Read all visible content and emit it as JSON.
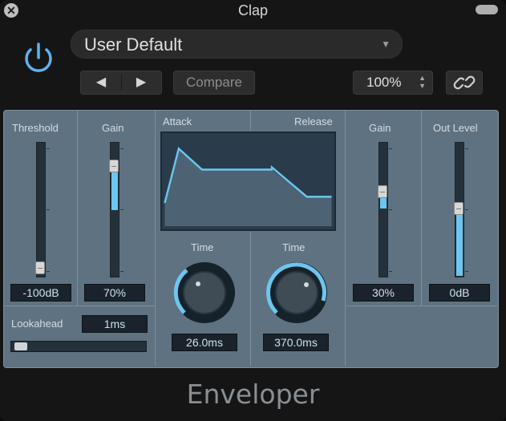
{
  "window": {
    "title": "Clap"
  },
  "header": {
    "preset": "User Default",
    "nav_prev": "◀",
    "nav_next": "▶",
    "compare": "Compare",
    "zoom": "100%"
  },
  "threshold": {
    "label": "Threshold",
    "value": "-100dB",
    "fraction": 0.0
  },
  "gain_left": {
    "label": "Gain",
    "value": "70%",
    "fraction": 0.7
  },
  "lookahead": {
    "label": "Lookahead",
    "value": "1ms"
  },
  "attack": {
    "section_label": "Attack",
    "time_label": "Time",
    "value": "26.0ms"
  },
  "release": {
    "section_label": "Release",
    "time_label": "Time",
    "value": "370.0ms"
  },
  "gain_right": {
    "label": "Gain",
    "value": "30%",
    "fraction": 0.3
  },
  "out_level": {
    "label": "Out Level",
    "value": "0dB"
  },
  "brand": "Enveloper",
  "colors": {
    "accent": "#6cc6ef",
    "panel": "#5f7281",
    "display": "#2a3c4b"
  }
}
